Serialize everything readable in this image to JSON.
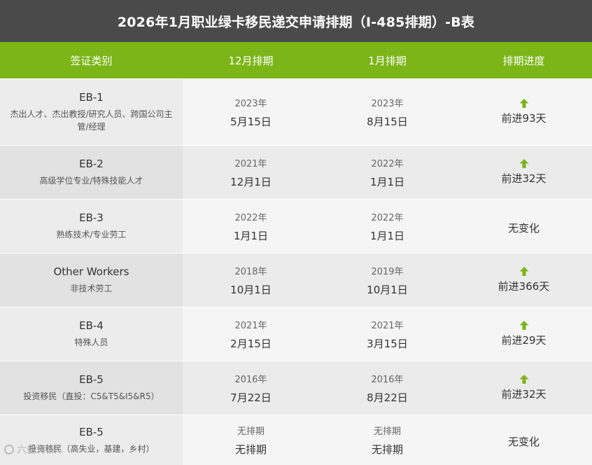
{
  "title": "2026年1月职业绿卡移民递交申请排期（I-485排期）-B表",
  "headers": [
    "签证类别",
    "12月排期",
    "1月排期",
    "排期进度"
  ],
  "colors": {
    "title_bg": "#4a4a4a",
    "header_bg": "#7cb518",
    "arrow": "#7cb518"
  },
  "rows": [
    {
      "category": "EB-1",
      "description": "杰出人才、杰出教授/研究人员、跨国公司主管/经理",
      "dec_year": "2023年",
      "dec_date": "5月15日",
      "jan_year": "2023年",
      "jan_date": "8月15日",
      "arrow": true,
      "progress": "前进93天"
    },
    {
      "category": "EB-2",
      "description": "高级学位专业/特殊技能人才",
      "dec_year": "2021年",
      "dec_date": "12月1日",
      "jan_year": "2022年",
      "jan_date": "1月1日",
      "arrow": true,
      "progress": "前进32天"
    },
    {
      "category": "EB-3",
      "description": "熟练技术/专业劳工",
      "dec_year": "2022年",
      "dec_date": "1月1日",
      "jan_year": "2022年",
      "jan_date": "1月1日",
      "arrow": false,
      "progress": "无变化"
    },
    {
      "category": "Other Workers",
      "description": "非技术劳工",
      "dec_year": "2018年",
      "dec_date": "10月1日",
      "jan_year": "2019年",
      "jan_date": "10月1日",
      "arrow": true,
      "progress": "前进366天"
    },
    {
      "category": "EB-4",
      "description": "特殊人员",
      "dec_year": "2021年",
      "dec_date": "2月15日",
      "jan_year": "2021年",
      "jan_date": "3月15日",
      "arrow": true,
      "progress": "前进29天"
    },
    {
      "category": "EB-5",
      "description": "投资移民（直投：C5&T5&I5&R5）",
      "dec_year": "2016年",
      "dec_date": "7月22日",
      "jan_year": "2016年",
      "jan_date": "8月22日",
      "arrow": true,
      "progress": "前进32天"
    },
    {
      "category": "EB-5",
      "description": "投资移民（高失业，基建，乡村）",
      "dec_year": "无排期",
      "dec_date": "无排期",
      "jan_year": "无排期",
      "jan_date": "无排期",
      "arrow": false,
      "progress": "无变化"
    }
  ],
  "watermark": "六度传媒"
}
